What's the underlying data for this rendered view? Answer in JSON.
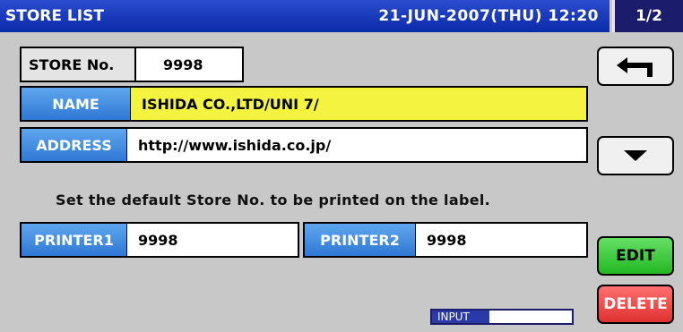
{
  "header": {
    "title": "STORE LIST",
    "datetime": "21-JUN-2007(THU) 12:20",
    "page_indicator": "1/2"
  },
  "store_no": {
    "label": "STORE No.",
    "value": "9998"
  },
  "name": {
    "label": "NAME",
    "value": "ISHIDA CO.,LTD/UNI 7/"
  },
  "address": {
    "label": "ADDRESS",
    "value": "http://www.ishida.co.jp/"
  },
  "hint_text": "Set the default Store No. to be printed on the label.",
  "printers": [
    {
      "label": "PRINTER1",
      "value": "9998"
    },
    {
      "label": "PRINTER2",
      "value": "9998"
    }
  ],
  "buttons": {
    "back_icon": "return-arrow-icon",
    "down_icon": "triangle-down-icon",
    "edit_label": "EDIT",
    "delete_label": "DELETE"
  },
  "input_indicator": {
    "label": "INPUT"
  },
  "colors": {
    "title_bar": "#0a2aa8",
    "field_label": "#2f78d4",
    "name_highlight": "#f4f440",
    "edit_button": "#22b822",
    "delete_button": "#e03030"
  }
}
